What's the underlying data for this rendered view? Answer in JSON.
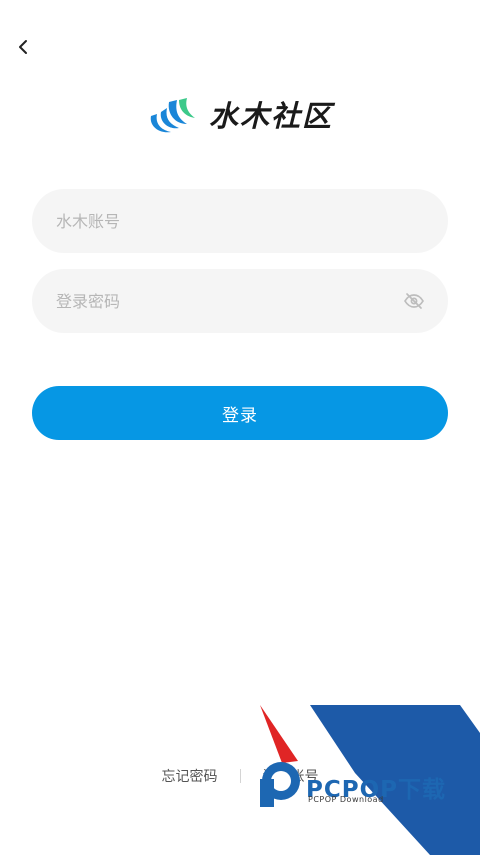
{
  "header": {
    "back_icon": "chevron-left-icon"
  },
  "logo": {
    "wordmark": "水木社区",
    "colors": {
      "blue": "#1a86d8",
      "green": "#3cc98a"
    }
  },
  "form": {
    "username_placeholder": "水木账号",
    "password_placeholder": "登录密码",
    "password_toggle_icon": "eye-off-icon",
    "login_label": "登录",
    "login_color": "#0697e4"
  },
  "footer": {
    "forgot_label": "忘记密码",
    "register_label": "注册账号"
  },
  "watermark": {
    "title": "PCPOP下载",
    "subtitle": "PCPOP Download",
    "color": "#1d67b2"
  }
}
